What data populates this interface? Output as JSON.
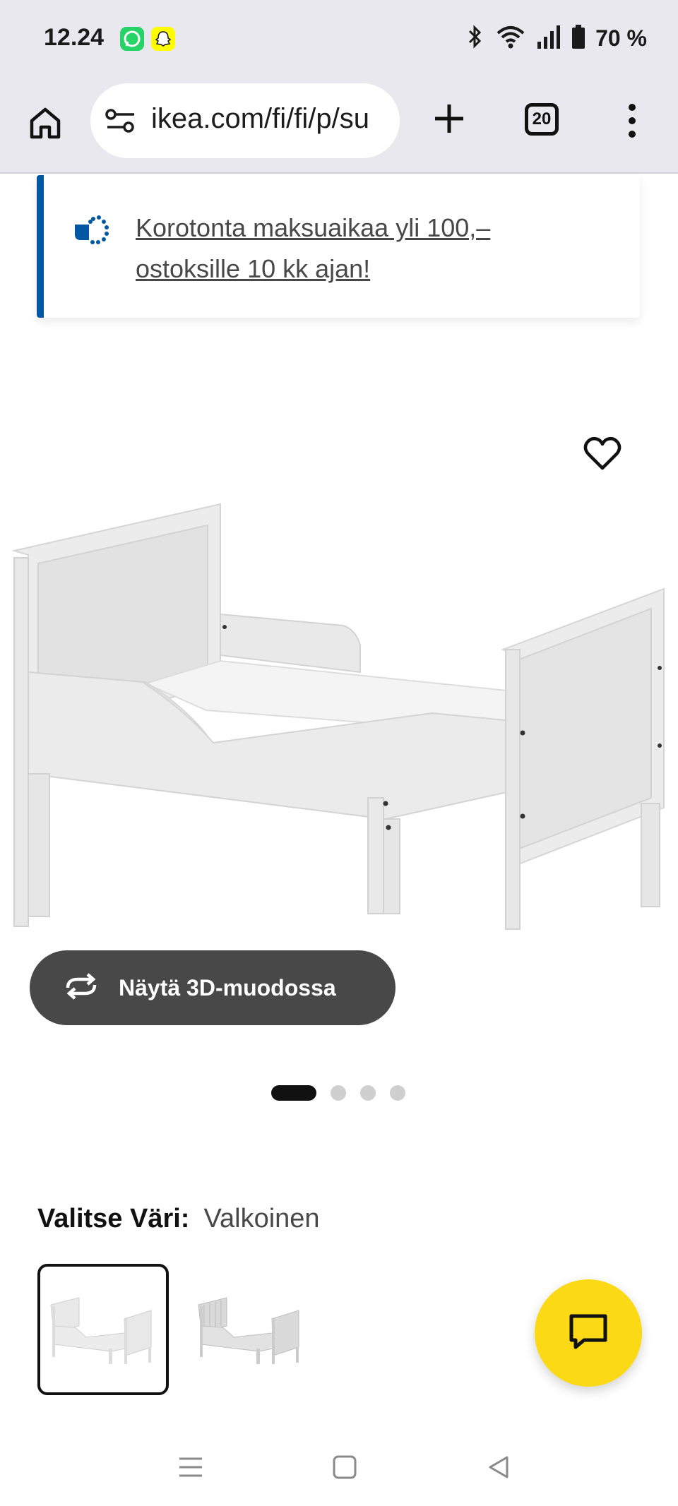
{
  "status_bar": {
    "time": "12.24",
    "battery_text": "70 %",
    "app_icons": [
      "whatsapp-icon",
      "snapchat-icon"
    ],
    "system_icons": [
      "bluetooth-icon",
      "wifi-icon",
      "signal-icon",
      "battery-icon"
    ]
  },
  "browser": {
    "url": "ikea.com/fi/fi/p/su",
    "tab_count": "20"
  },
  "banner": {
    "text": "Korotonta maksuaikaa yli 100,– ostoksille 10 kk ajan!",
    "accent": "#0058a3"
  },
  "product": {
    "view_3d_label": "Näytä 3D-muodossa",
    "image_count": 4,
    "active_image": 1,
    "color_label": "Valitse Väri:",
    "color_value": "Valkoinen"
  },
  "colors": {
    "chat_button": "#fbd914",
    "button_3d": "#484848"
  }
}
